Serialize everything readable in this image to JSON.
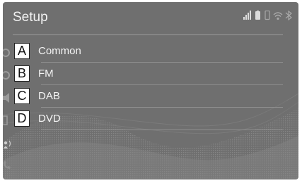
{
  "screen": {
    "title": "Setup"
  },
  "menu": {
    "items": [
      {
        "badge": "A",
        "label": "Common"
      },
      {
        "badge": "B",
        "label": "FM"
      },
      {
        "badge": "C",
        "label": "DAB"
      },
      {
        "badge": "D",
        "label": "DVD"
      }
    ]
  },
  "status_icons": [
    "signal-strength-icon",
    "battery-icon",
    "phone-icon",
    "wifi-icon",
    "bluetooth-icon"
  ],
  "side_icons": [
    "settings-icon",
    "settings-icon",
    "audio-icon",
    "display-icon",
    "voice-icon",
    "phone-icon"
  ],
  "colors": {
    "background": "#6f6f6f",
    "text": "#f2f2f2",
    "badge_background": "#ffffff",
    "badge_text": "#111111"
  }
}
